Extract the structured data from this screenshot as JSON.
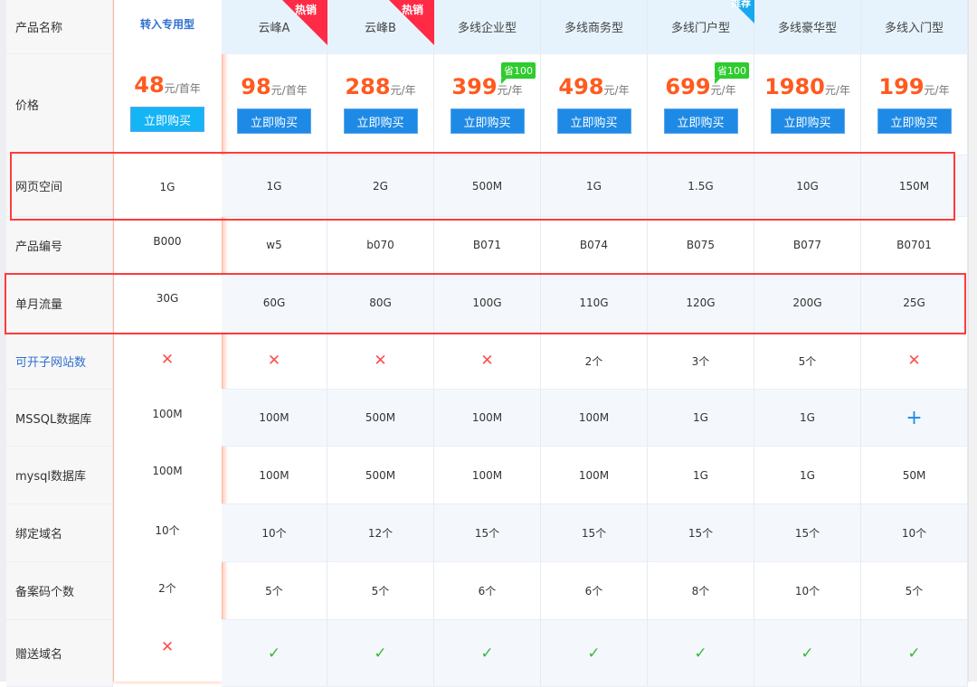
{
  "row_labels": [
    "产品名称",
    "价格",
    "网页空间",
    "产品编号",
    "单月流量",
    "可开子网站数",
    "MSSQL数据库",
    "mysql数据库",
    "绑定域名",
    "备案码个数",
    "赠送域名"
  ],
  "buy_label": "立即购买",
  "products": [
    {
      "name": "转入专用型",
      "price": "48",
      "unit": "元/首年",
      "featured": true,
      "values": [
        "1G",
        "B000",
        "30G",
        "x",
        "100M",
        "100M",
        "10个",
        "2个",
        "x"
      ]
    },
    {
      "name": "云峰A",
      "price": "98",
      "unit": "元/首年",
      "ribbon": "热销",
      "values": [
        "1G",
        "w5",
        "60G",
        "x",
        "100M",
        "100M",
        "10个",
        "5个",
        "check"
      ]
    },
    {
      "name": "云峰B",
      "price": "288",
      "unit": "元/年",
      "ribbon": "热销",
      "values": [
        "2G",
        "b070",
        "80G",
        "x",
        "500M",
        "500M",
        "12个",
        "5个",
        "check"
      ]
    },
    {
      "name": "多线企业型",
      "price": "399",
      "unit": "元/年",
      "save": "省100",
      "values": [
        "500M",
        "B071",
        "100G",
        "x",
        "100M",
        "100M",
        "15个",
        "6个",
        "check"
      ]
    },
    {
      "name": "多线商务型",
      "price": "498",
      "unit": "元/年",
      "values": [
        "1G",
        "B074",
        "110G",
        "2个",
        "100M",
        "100M",
        "15个",
        "6个",
        "check"
      ]
    },
    {
      "name": "多线门户型",
      "price": "699",
      "unit": "元/年",
      "save": "省100",
      "corner": "推荐",
      "values": [
        "1.5G",
        "B075",
        "120G",
        "3个",
        "1G",
        "1G",
        "15个",
        "8个",
        "check"
      ]
    },
    {
      "name": "多线豪华型",
      "price": "1980",
      "unit": "元/年",
      "values": [
        "10G",
        "B077",
        "200G",
        "5个",
        "1G",
        "1G",
        "15个",
        "10个",
        "check"
      ]
    },
    {
      "name": "多线入门型",
      "price": "199",
      "unit": "元/年",
      "values": [
        "150M",
        "B0701",
        "25G",
        "x",
        "plus",
        "50M",
        "10个",
        "5个",
        "check"
      ]
    }
  ],
  "colors": {
    "price": "#ff5a1f",
    "buy": "#1f8ae6",
    "hot": "#ff2a45",
    "save": "#2ecc2e",
    "highlight": "#ff3b3b"
  }
}
